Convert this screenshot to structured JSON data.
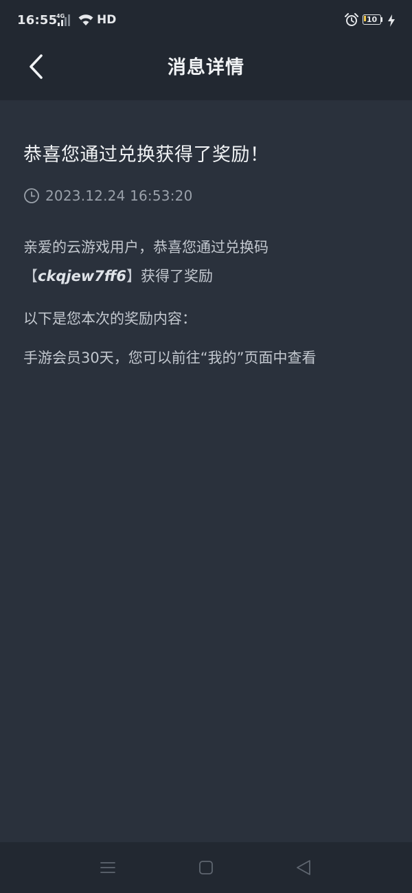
{
  "status_bar": {
    "time": "16:55",
    "network_type": "4G",
    "wifi_label": "HD",
    "battery_level": "10",
    "icons": [
      "signal-icon",
      "wifi-icon",
      "alarm-icon",
      "battery-icon",
      "charging-icon"
    ]
  },
  "header": {
    "back_icon": "chevron-left-icon",
    "title": "消息详情"
  },
  "message": {
    "title": "恭喜您通过兑换获得了奖励！",
    "time_icon": "clock-icon",
    "time": "2023.12.24 16:53:20",
    "line1": "亲爱的云游戏用户，恭喜您通过兑换码",
    "bracket_open": "【",
    "code": "ckqjew7ff6",
    "bracket_close": "】",
    "line2_suffix": "获得了奖励",
    "line3": "以下是您本次的奖励内容：",
    "line4": "手游会员30天，您可以前往“我的”页面中查看"
  },
  "nav_bar": {
    "icons": [
      "menu-icon",
      "home-icon",
      "back-triangle-icon"
    ]
  },
  "colors": {
    "background": "#2a313c",
    "bar_background": "#222831",
    "title_text": "#f1f3f5",
    "body_text": "#c3c8cf",
    "muted_text": "#9aa1aa",
    "battery_low": "#f2c94c"
  }
}
